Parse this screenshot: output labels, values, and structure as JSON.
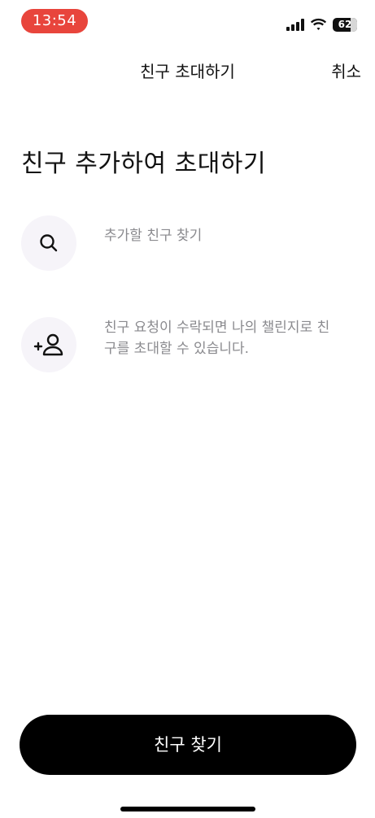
{
  "status_bar": {
    "time": "13:54",
    "battery": "62"
  },
  "nav": {
    "title": "친구 초대하기",
    "cancel_label": "취소"
  },
  "main": {
    "headline": "친구 추가하여 초대하기",
    "search_option": {
      "label": "추가할 친구 찾기",
      "icon": "search-icon"
    },
    "info_option": {
      "line1": "친구 요청이 수락되면 나의 챌린지로 친",
      "line2": "구를 초대할 수 있습니다.",
      "icon": "add-person-icon"
    }
  },
  "footer": {
    "find_friends_label": "친구 찾기"
  },
  "colors": {
    "time_pill": "#e8453c",
    "cta_bg": "#000000",
    "icon_circle": "#f6f4f9",
    "secondary_text": "#8a8a8e"
  }
}
